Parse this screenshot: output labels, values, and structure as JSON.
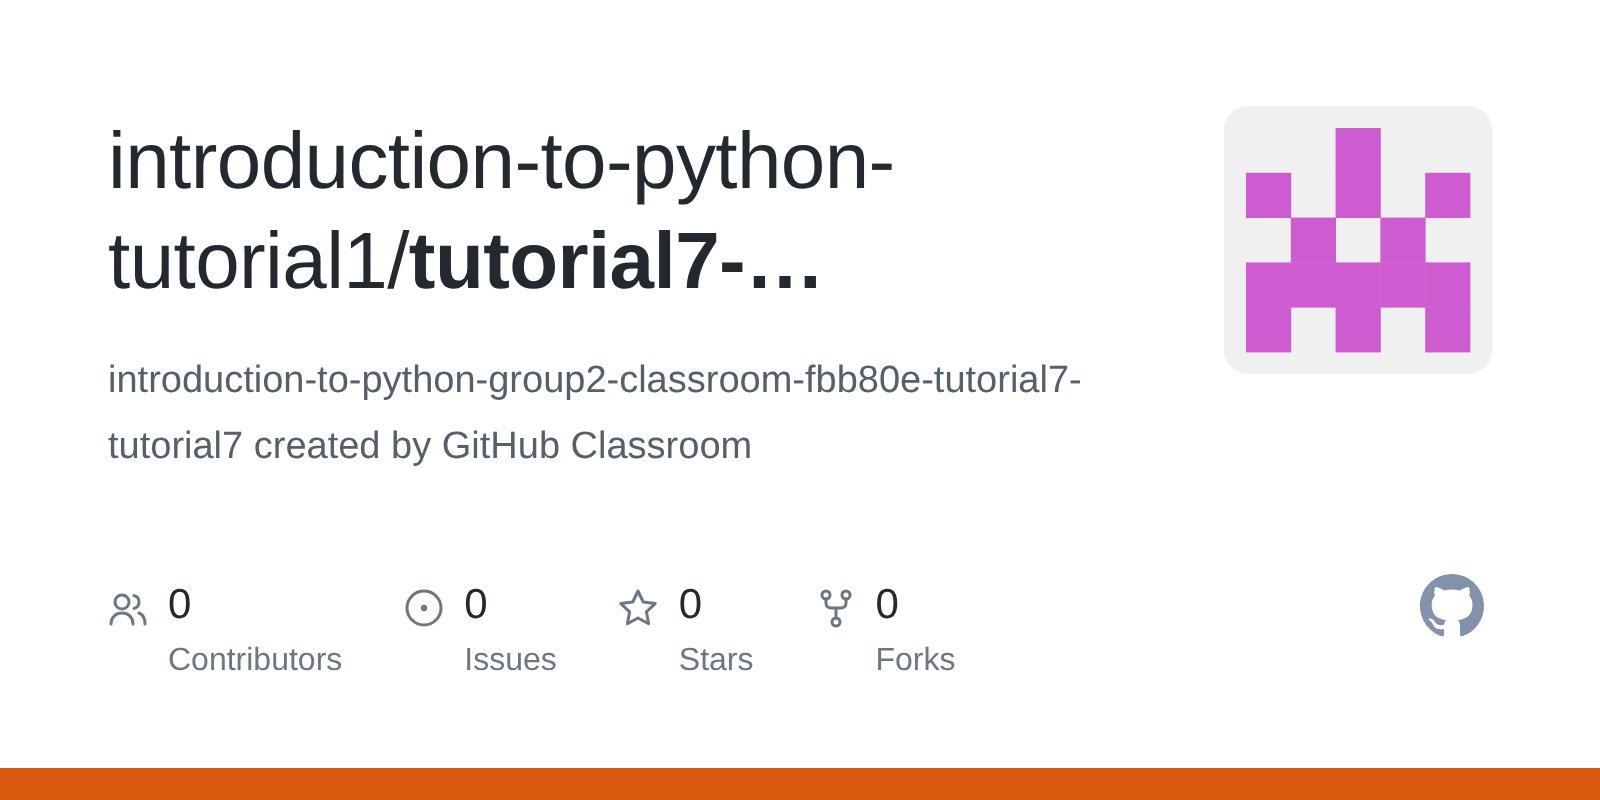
{
  "title": "introduction-to-python-tutorial1/**tutorial7-…**",
  "description": "introduction-to-python-group2-classroom-fbb80e-tutorial7-tutorial7 created by GitHub Classroom",
  "stats": [
    {
      "kind": "contributors",
      "count": "0",
      "label": "Contributors"
    },
    {
      "kind": "issues",
      "count": "0",
      "label": "Issues"
    },
    {
      "kind": "stars",
      "count": "0",
      "label": "Stars"
    },
    {
      "kind": "forks",
      "count": "0",
      "label": "Forks"
    }
  ]
}
